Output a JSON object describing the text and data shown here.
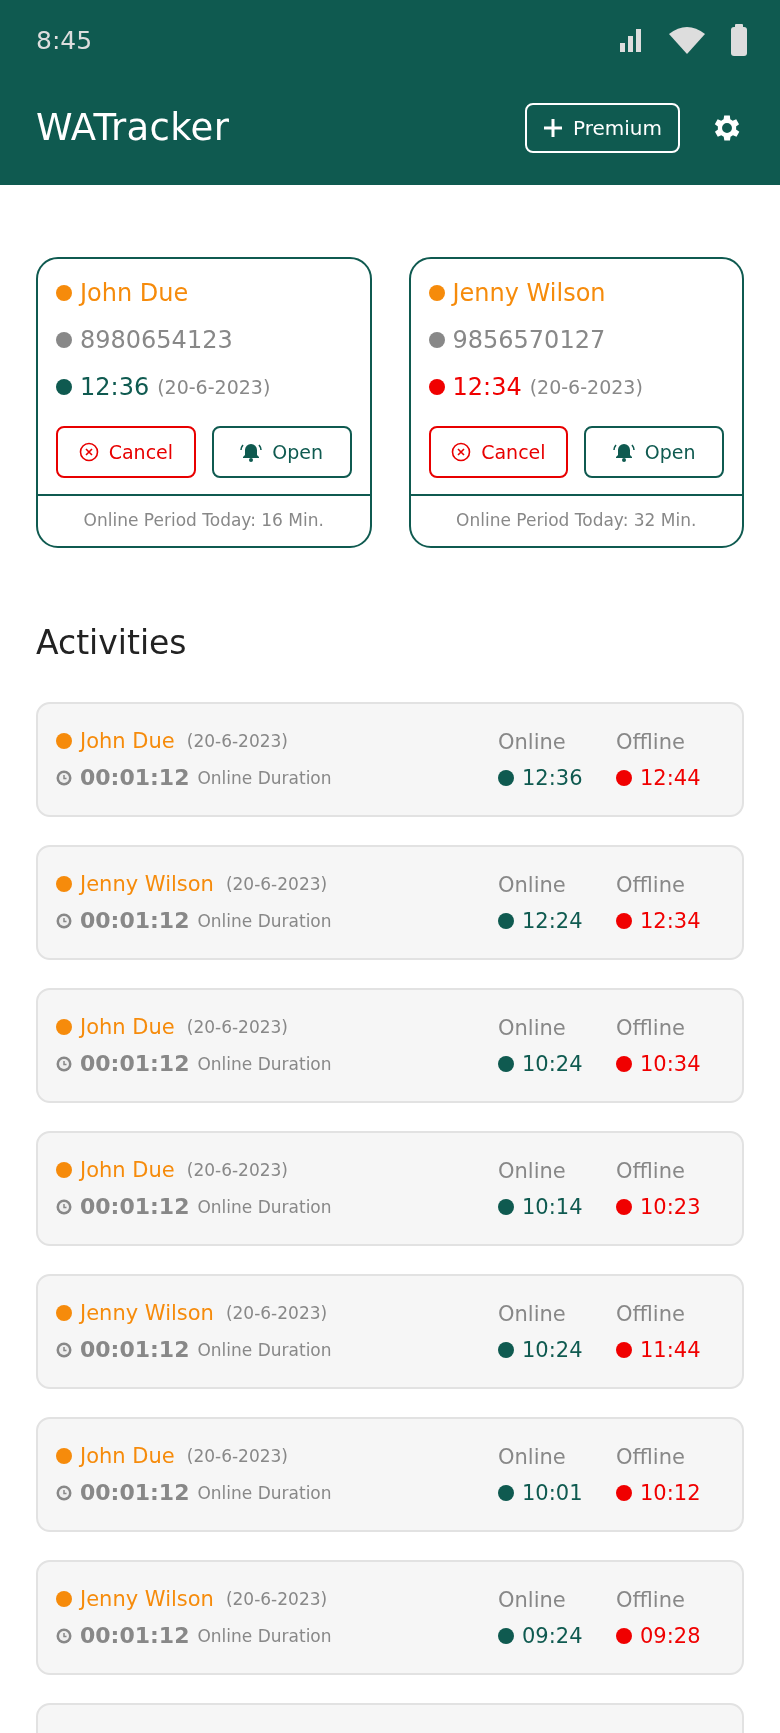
{
  "status_bar": {
    "time": "8:45"
  },
  "app_bar": {
    "title": "WATracker",
    "premium_button": "Premium"
  },
  "tracked_contacts": [
    {
      "name": "John Due",
      "phone": "8980654123",
      "last_seen_time": "12:36",
      "last_seen_date": "(20-6-2023)",
      "color": "#0f5a50",
      "cancel_label": "Cancel",
      "open_label": "Open",
      "footer": "Online Period Today: 16 Min."
    },
    {
      "name": "Jenny Wilson",
      "phone": "9856570127",
      "last_seen_time": "12:34",
      "last_seen_date": "(20-6-2023)",
      "color": "#f00000",
      "cancel_label": "Cancel",
      "open_label": "Open",
      "footer": "Online Period Today: 32 Min."
    }
  ],
  "activities_title": "Activities",
  "activities": [
    {
      "name": "John Due",
      "date": "(20-6-2023)",
      "duration": "00:01:12",
      "duration_label": "Online Duration",
      "online_label": "Online",
      "online_time": "12:36",
      "offline_label": "Offline",
      "offline_time": "12:44"
    },
    {
      "name": "Jenny Wilson",
      "date": "(20-6-2023)",
      "duration": "00:01:12",
      "duration_label": "Online Duration",
      "online_label": "Online",
      "online_time": "12:24",
      "offline_label": "Offline",
      "offline_time": "12:34"
    },
    {
      "name": "John Due",
      "date": "(20-6-2023)",
      "duration": "00:01:12",
      "duration_label": "Online Duration",
      "online_label": "Online",
      "online_time": "10:24",
      "offline_label": "Offline",
      "offline_time": "10:34"
    },
    {
      "name": "John Due",
      "date": "(20-6-2023)",
      "duration": "00:01:12",
      "duration_label": "Online Duration",
      "online_label": "Online",
      "online_time": "10:14",
      "offline_label": "Offline",
      "offline_time": "10:23"
    },
    {
      "name": "Jenny Wilson",
      "date": "(20-6-2023)",
      "duration": "00:01:12",
      "duration_label": "Online Duration",
      "online_label": "Online",
      "online_time": "10:24",
      "offline_label": "Offline",
      "offline_time": "11:44"
    },
    {
      "name": "John Due",
      "date": "(20-6-2023)",
      "duration": "00:01:12",
      "duration_label": "Online Duration",
      "online_label": "Online",
      "online_time": "10:01",
      "offline_label": "Offline",
      "offline_time": "10:12"
    },
    {
      "name": "Jenny Wilson",
      "date": "(20-6-2023)",
      "duration": "00:01:12",
      "duration_label": "Online Duration",
      "online_label": "Online",
      "online_time": "09:24",
      "offline_label": "Offline",
      "offline_time": "09:28"
    }
  ]
}
